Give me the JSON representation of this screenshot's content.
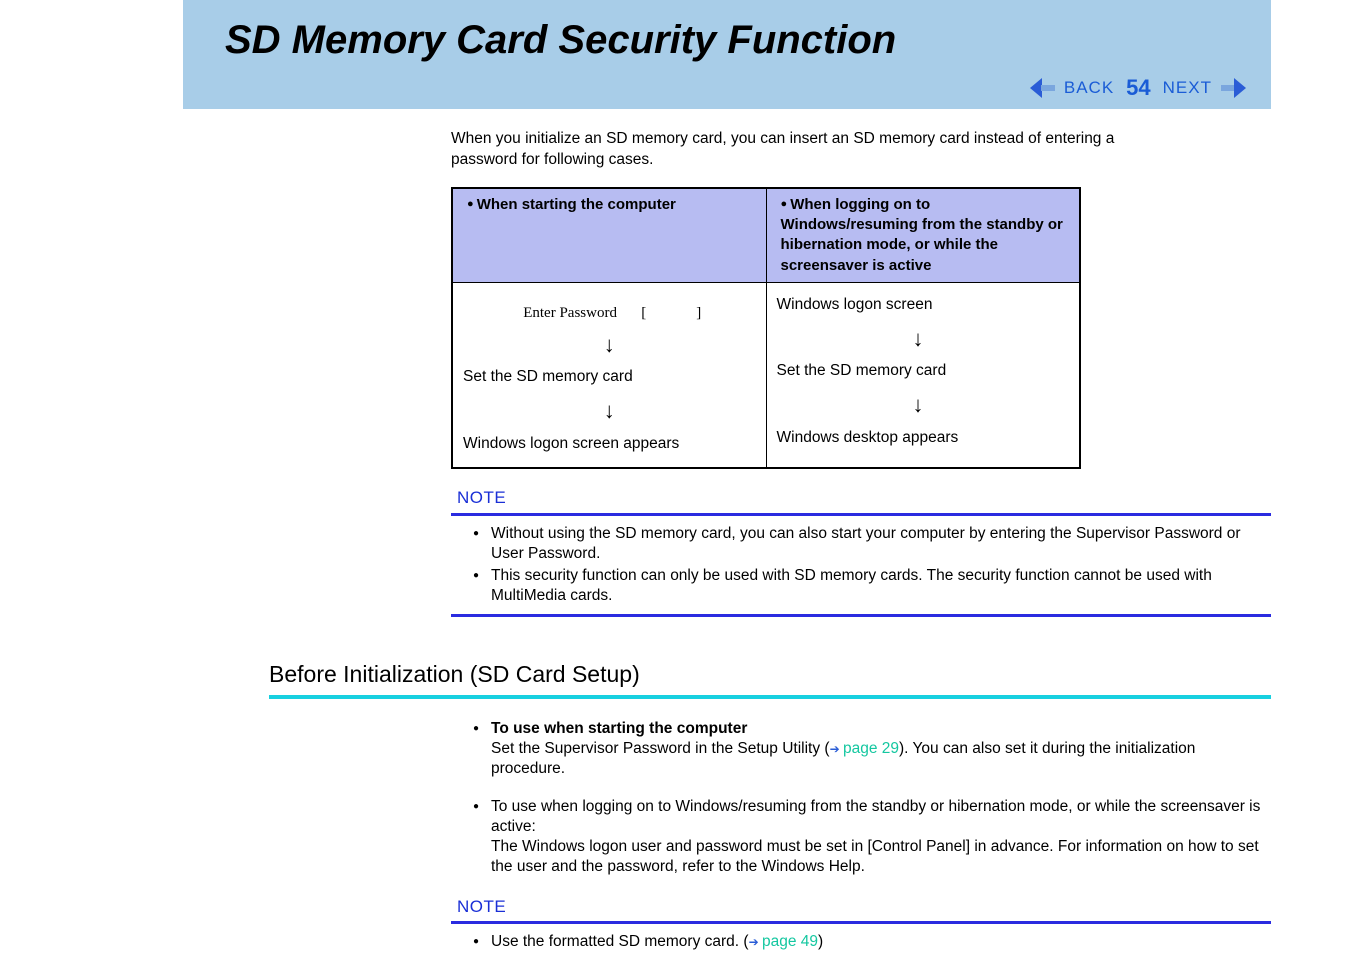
{
  "header": {
    "title": "SD Memory Card Security Function",
    "back_label": "BACK",
    "page_number": "54",
    "next_label": "NEXT"
  },
  "intro": "When you initialize an SD memory card, you can insert an SD memory card instead of entering a password for following cases.",
  "table": {
    "head_left": "When starting the computer",
    "head_right": "When logging on to Windows/resuming from the standby or hibernation mode, or while the screensaver is active",
    "left": {
      "enter_password": "Enter Password",
      "brackets": "[ ]",
      "step2": "Set the SD memory card",
      "step3": "Windows logon screen appears"
    },
    "right": {
      "step1": "Windows logon screen",
      "step2": "Set the SD memory card",
      "step3": "Windows desktop appears"
    }
  },
  "note1": {
    "heading": "NOTE",
    "items": [
      "Without using the SD memory card, you can also start your computer by entering the Supervisor Password or User Password.",
      "This security function can only be used with SD memory cards.  The security function cannot be used with MultiMedia cards."
    ]
  },
  "section": {
    "heading": "Before Initialization (SD Card Setup)",
    "bullet1_title": "To use when starting the computer",
    "bullet1_text_a": "Set the Supervisor Password in the Setup Utility (",
    "bullet1_link": "page 29",
    "bullet1_text_b": ").  You can also set it during the initialization procedure.",
    "bullet2_a": "To use when logging on to Windows/resuming from the standby or hibernation mode, or while the screensaver is active:",
    "bullet2_b": "The Windows logon user and password must be set in [Control Panel] in advance. For information on how to set the user and the password, refer to the Windows Help."
  },
  "note2": {
    "heading": "NOTE",
    "item_a": "Use the formatted SD memory card. (",
    "item_link": "page 49",
    "item_b": ")"
  }
}
